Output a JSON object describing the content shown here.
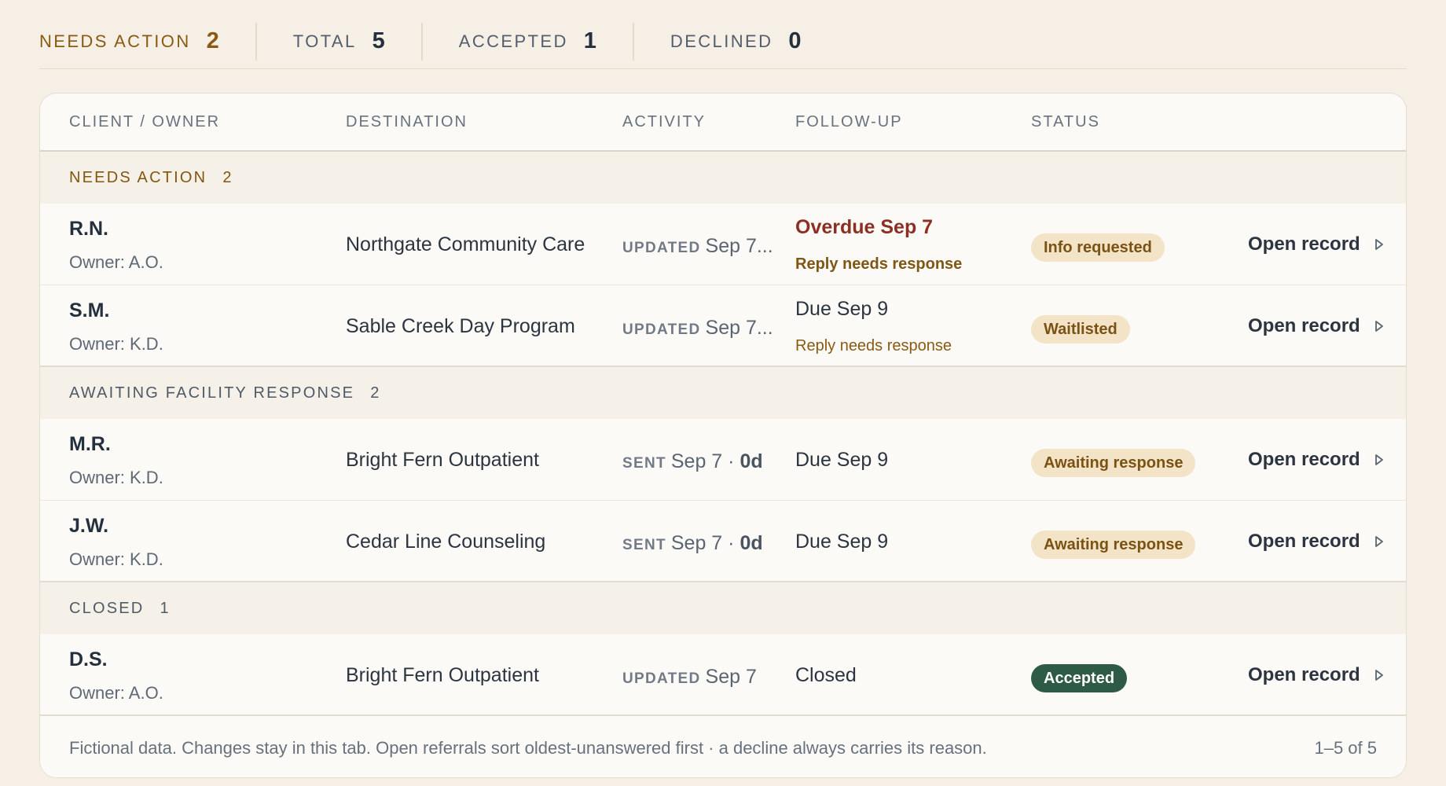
{
  "stats": [
    {
      "label": "NEEDS ACTION",
      "value": "2"
    },
    {
      "label": "TOTAL",
      "value": "5"
    },
    {
      "label": "ACCEPTED",
      "value": "1"
    },
    {
      "label": "DECLINED",
      "value": "0"
    }
  ],
  "columns": {
    "client": "CLIENT / OWNER",
    "destination": "DESTINATION",
    "activity": "ACTIVITY",
    "follow_up": "FOLLOW-UP",
    "status": "STATUS"
  },
  "groups": [
    {
      "label": "NEEDS ACTION",
      "count": "2",
      "rows": [
        {
          "name": "R.N.",
          "owner": "Owner: A.O.",
          "destination": "Northgate Community Care",
          "activity_tag": "UPDATED",
          "activity_text": "Sep 7...",
          "activity_days": "",
          "follow_main": "Overdue Sep 7",
          "follow_sub": "Reply needs response",
          "status": "Info requested",
          "open": "Open record"
        },
        {
          "name": "S.M.",
          "owner": "Owner: K.D.",
          "destination": "Sable Creek Day Program",
          "activity_tag": "UPDATED",
          "activity_text": "Sep 7...",
          "activity_days": "",
          "follow_main": "Due Sep 9",
          "follow_sub": "Reply needs response",
          "status": "Waitlisted",
          "open": "Open record"
        }
      ]
    },
    {
      "label": "AWAITING FACILITY RESPONSE",
      "count": "2",
      "rows": [
        {
          "name": "M.R.",
          "owner": "Owner: K.D.",
          "destination": "Bright Fern Outpatient",
          "activity_tag": "SENT",
          "activity_text": "Sep 7 · ",
          "activity_days": "0d",
          "follow_main": "Due Sep 9",
          "follow_sub": "",
          "status": "Awaiting response",
          "open": "Open record"
        },
        {
          "name": "J.W.",
          "owner": "Owner: K.D.",
          "destination": "Cedar Line Counseling",
          "activity_tag": "SENT",
          "activity_text": "Sep 7 · ",
          "activity_days": "0d",
          "follow_main": "Due Sep 9",
          "follow_sub": "",
          "status": "Awaiting response",
          "open": "Open record"
        }
      ]
    },
    {
      "label": "CLOSED",
      "count": "1",
      "rows": [
        {
          "name": "D.S.",
          "owner": "Owner: A.O.",
          "destination": "Bright Fern Outpatient",
          "activity_tag": "UPDATED",
          "activity_text": "Sep 7",
          "activity_days": "",
          "follow_main": "Closed",
          "follow_sub": "",
          "status": "Accepted",
          "open": "Open record"
        }
      ]
    }
  ],
  "footer": {
    "note": "Fictional data. Changes stay in this tab. Open referrals sort oldest-unanswered first · a decline always carries its reason.",
    "range": "1–5 of 5"
  },
  "colors": {
    "background": "#f5efe5",
    "accent_amber": "#8a5a12",
    "overdue_red": "#8c2f22",
    "accepted_green": "#2e5b45"
  }
}
